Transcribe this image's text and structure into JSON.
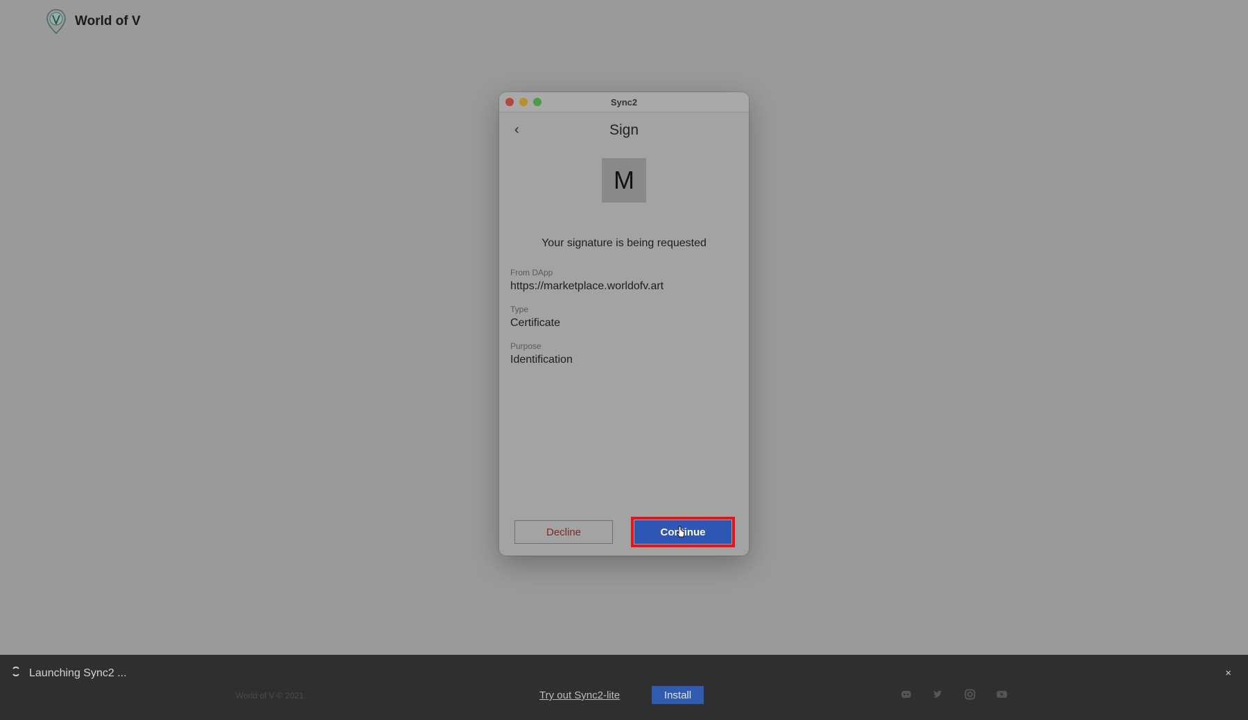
{
  "header": {
    "brand_name": "World of V",
    "logo_icon": "world-of-v-logo-icon"
  },
  "dialog": {
    "window_title": "Sync2",
    "page_title": "Sign",
    "back_icon": "chevron-left-icon",
    "avatar_letter": "M",
    "request_text": "Your signature is being requested",
    "fields": [
      {
        "label": "From DApp",
        "value": "https://marketplace.worldofv.art"
      },
      {
        "label": "Type",
        "value": "Certificate"
      },
      {
        "label": "Purpose",
        "value": "Identification"
      }
    ],
    "decline_label": "Decline",
    "continue_label": "Continue"
  },
  "bottom_bar": {
    "launching_text": "Launching Sync2 ...",
    "close_label": "×",
    "copyright": "World of V © 2021",
    "tryout_label": "Try out Sync2-lite",
    "install_label": "Install",
    "social_icons": [
      "discord-icon",
      "twitter-icon",
      "instagram-icon",
      "youtube-icon"
    ]
  },
  "colors": {
    "accent": "#2f56b5",
    "highlight": "#e4141c",
    "bar": "#2f2f2f"
  }
}
